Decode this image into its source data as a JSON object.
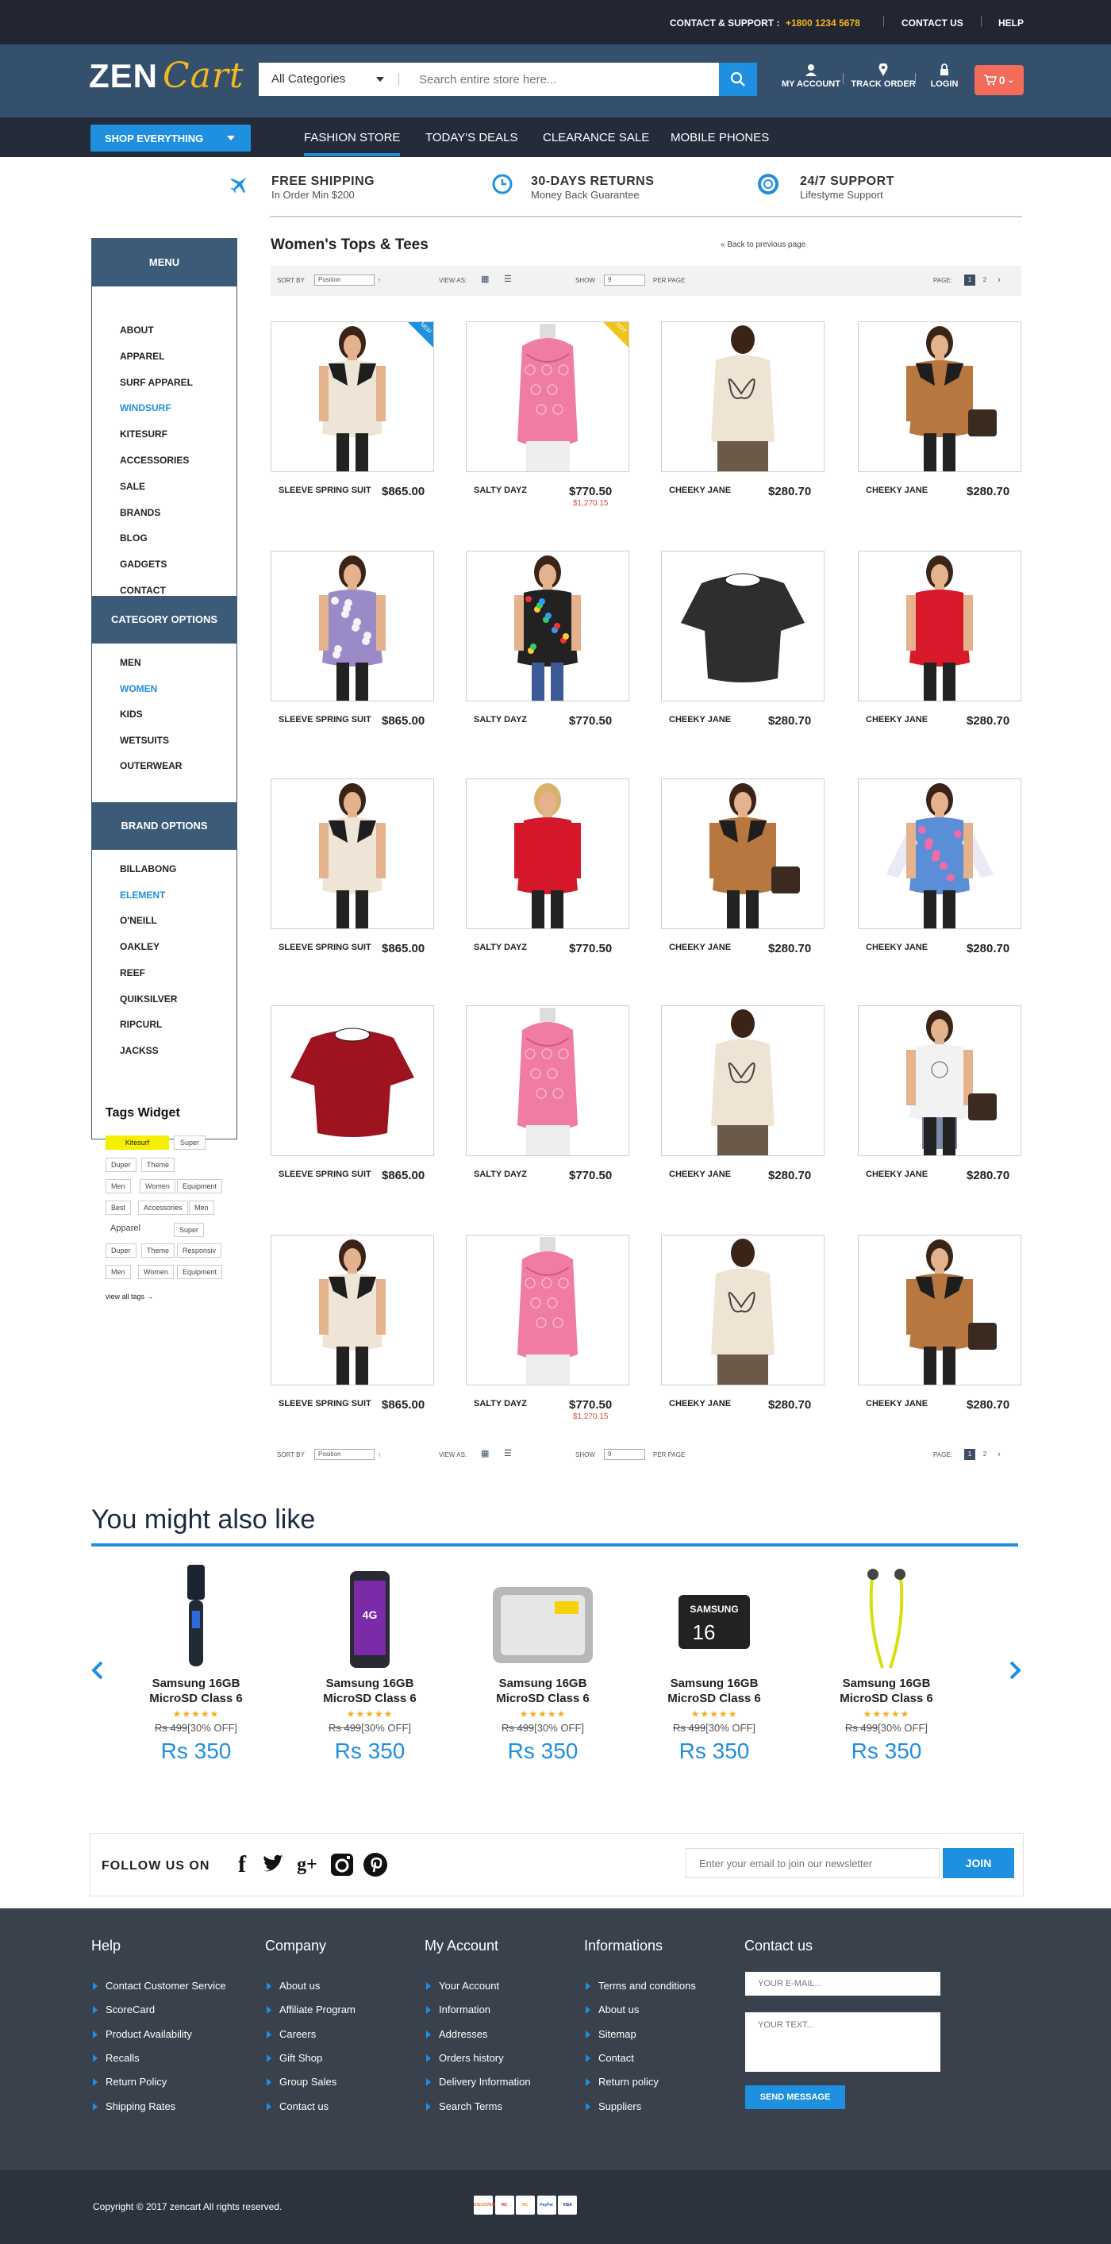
{
  "topbar": {
    "support_label": "CONTACT & SUPPORT :",
    "phone": "+1800 1234 5678",
    "contact": "CONTACT US",
    "help": "HELP"
  },
  "logo": {
    "zen": "ZEN",
    "cart": "Cart"
  },
  "search": {
    "category": "All Categories",
    "placeholder": "Search entire store here..."
  },
  "header_icons": {
    "account": "MY ACCOUNT",
    "track": "TRACK ORDER",
    "login": "LOGIN",
    "cart_count": "0"
  },
  "nav": {
    "shop": "SHOP EVERYTHING",
    "links": [
      "FASHION STORE",
      "TODAY'S DEALS",
      "CLEARANCE SALE",
      "MOBILE  PHONES"
    ]
  },
  "features": [
    {
      "title": "FREE SHIPPING",
      "sub": "In Order Min $200"
    },
    {
      "title": "30-DAYS RETURNS",
      "sub": "Money Back  Guarantee"
    },
    {
      "title": "24/7 SUPPORT",
      "sub": "Lifestyme Support"
    }
  ],
  "sidebar": {
    "menu_title": "MENU",
    "menu": [
      "ABOUT",
      "APPAREL",
      "SURF APPAREL",
      "WINDSURF",
      "KITESURF",
      "ACCESSORIES",
      "SALE",
      "BRANDS",
      "BLOG",
      "GADGETS",
      "CONTACT"
    ],
    "category_title": "CATEGORY OPTIONS",
    "categories": [
      "MEN",
      "WOMEN",
      "KIDS",
      "WETSUITS",
      "OUTERWEAR"
    ],
    "brand_title": "BRAND OPTIONS",
    "brands": [
      "BILLABONG",
      "ELEMENT",
      "O'NEILL",
      "OAKLEY",
      "REEF",
      "QUIKSILVER",
      "RIPCURL",
      "JACKSS"
    ],
    "tags_title": "Tags Widget",
    "tags": [
      "Kitesurf",
      "Super",
      "Duper",
      "Theme",
      "Men",
      "Women",
      "Equipment",
      "Best",
      "Accessories",
      "Men",
      "Apparel",
      "Super",
      "Duper",
      "Theme",
      "Responsiv",
      "Men",
      "Women",
      "Equipment"
    ],
    "view_all": "view all tags  →"
  },
  "main": {
    "title": "Women's Tops & Tees",
    "back": "«  Back to previous page",
    "toolbar": {
      "sort_by": "SORT BY",
      "sort_value": "Position",
      "view_as": "VIEW AS:",
      "show": "SHOW",
      "show_value": "9",
      "per_page": "PER PAGE",
      "page": "PAGE:",
      "pages": [
        "1",
        "2"
      ],
      "next": "›"
    },
    "badges": {
      "new": "NEW",
      "hot": "HOT"
    },
    "products": [
      {
        "name": "SLEEVE SPRING SUIT",
        "price": "$865.00",
        "old": ""
      },
      {
        "name": "SALTY DAYZ",
        "price": "$770.50",
        "old": "$1,270.15"
      },
      {
        "name": "CHEEKY JANE",
        "price": "$280.70",
        "old": ""
      },
      {
        "name": "CHEEKY JANE",
        "price": "$280.70",
        "old": ""
      },
      {
        "name": "SLEEVE SPRING SUIT",
        "price": "$865.00",
        "old": ""
      },
      {
        "name": "SALTY DAYZ",
        "price": "$770.50",
        "old": ""
      },
      {
        "name": "CHEEKY JANE",
        "price": "$280.70",
        "old": ""
      },
      {
        "name": "CHEEKY JANE",
        "price": "$280.70",
        "old": ""
      },
      {
        "name": "SLEEVE SPRING SUIT",
        "price": "$865.00",
        "old": ""
      },
      {
        "name": "SALTY DAYZ",
        "price": "$770.50",
        "old": ""
      },
      {
        "name": "CHEEKY JANE",
        "price": "$280.70",
        "old": ""
      },
      {
        "name": "CHEEKY JANE",
        "price": "$280.70",
        "old": ""
      },
      {
        "name": "SLEEVE SPRING SUIT",
        "price": "$865.00",
        "old": ""
      },
      {
        "name": "SALTY DAYZ",
        "price": "$770.50",
        "old": ""
      },
      {
        "name": "CHEEKY JANE",
        "price": "$280.70",
        "old": ""
      },
      {
        "name": "CHEEKY JANE",
        "price": "$280.70",
        "old": ""
      },
      {
        "name": "SLEEVE SPRING SUIT",
        "price": "$865.00",
        "old": ""
      },
      {
        "name": "SALTY DAYZ",
        "price": "$770.50",
        "old": "$1,270.15"
      },
      {
        "name": "CHEEKY JANE",
        "price": "$280.70",
        "old": ""
      },
      {
        "name": "CHEEKY JANE",
        "price": "$280.70",
        "old": ""
      }
    ]
  },
  "related": {
    "title": "You might also like",
    "items": [
      {
        "name": "Samsung 16GB MicroSD Class 6",
        "old": "Rs 499",
        "off": "[30% OFF]",
        "price": "Rs 350",
        "stars": "★★★★★"
      },
      {
        "name": "Samsung 16GB MicroSD Class 6",
        "old": "Rs 499",
        "off": "[30% OFF]",
        "price": "Rs 350",
        "stars": "★★★★★"
      },
      {
        "name": "Samsung 16GB MicroSD Class 6",
        "old": "Rs 499",
        "off": "[30% OFF]",
        "price": "Rs 350",
        "stars": "★★★★★"
      },
      {
        "name": "Samsung 16GB MicroSD Class 6",
        "old": "Rs 499",
        "off": "[30% OFF]",
        "price": "Rs 350",
        "stars": "★★★★★"
      },
      {
        "name": "Samsung 16GB MicroSD Class 6",
        "old": "Rs 499",
        "off": "[30% OFF]",
        "price": "Rs 350",
        "stars": "★★★★★"
      }
    ],
    "sd_brand": "SAMSUNG",
    "sd_size": "16",
    "phone_text": "4G"
  },
  "follow": {
    "label": "FOLLOW US ON",
    "newsletter_placeholder": "Enter your email to join our newsletter",
    "join": "JOIN"
  },
  "footer": {
    "cols": [
      {
        "title": "Help",
        "links": [
          "Contact Customer Service",
          "ScoreCard",
          "Product Availability",
          "Recalls",
          "Return Policy",
          "Shipping Rates"
        ]
      },
      {
        "title": "Company",
        "links": [
          "About us",
          "Affiliate Program",
          "Careers",
          "Gift Shop",
          "Group Sales",
          "Contact us"
        ]
      },
      {
        "title": "My Account",
        "links": [
          "Your Account",
          "Information",
          "Addresses",
          "Orders history",
          "Delivery Information",
          "Search Terms"
        ]
      },
      {
        "title": "Informations",
        "links": [
          "Terms and conditions",
          "About us",
          "Sitemap",
          "Contact",
          "Return policy",
          "Suppliers"
        ]
      }
    ],
    "contact_title": "Contact us",
    "email_placeholder": "YOUR E-MAIL...",
    "text_placeholder": "YOUR TEXT...",
    "send": "SEND MESSAGE",
    "copyright": "Copyright © 2017 zencart All rights reserved.",
    "payments": [
      "DISCOVER",
      "MC",
      "MC",
      "PayPal",
      "VISA"
    ]
  },
  "colors": {
    "accent": "#1f8fe0",
    "header": "#34506c",
    "nav": "#242c3b",
    "footer": "#38414c",
    "sale": "#e04a3a",
    "cart": "#f26b5b",
    "logo_yellow": "#f5b91d"
  }
}
